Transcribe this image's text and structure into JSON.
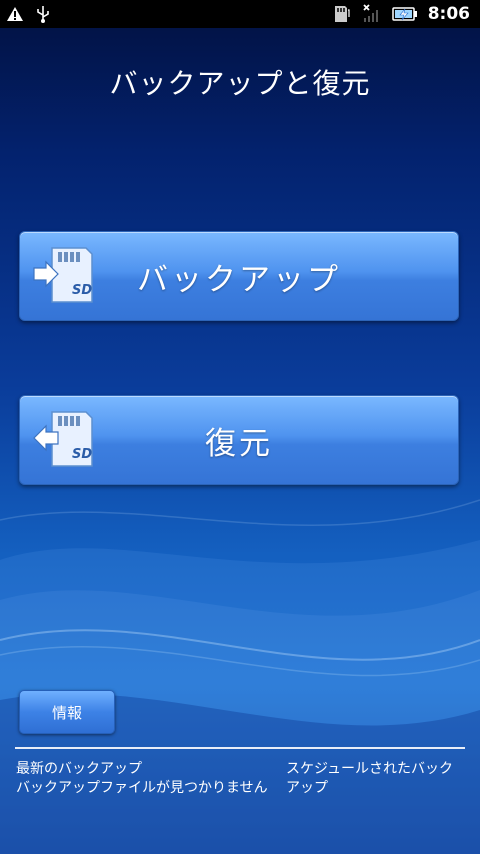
{
  "status_bar": {
    "time": "8:06",
    "icons": [
      "warning-icon",
      "usb-icon",
      "sd-card-icon",
      "signal-off-icon",
      "battery-charging-icon"
    ]
  },
  "title": "バックアップと復元",
  "buttons": {
    "backup_label": "バックアップ",
    "restore_label": "復元",
    "info_label": "情報"
  },
  "info": {
    "latest_backup_heading": "最新のバックアップ",
    "latest_backup_value": "バックアップファイルが見つかりません",
    "scheduled_backup_heading": "スケジュールされたバックアップ"
  },
  "colors": {
    "button": "#4f93ef",
    "background_top": "#02103f",
    "background_bottom": "#1a6fd0"
  }
}
